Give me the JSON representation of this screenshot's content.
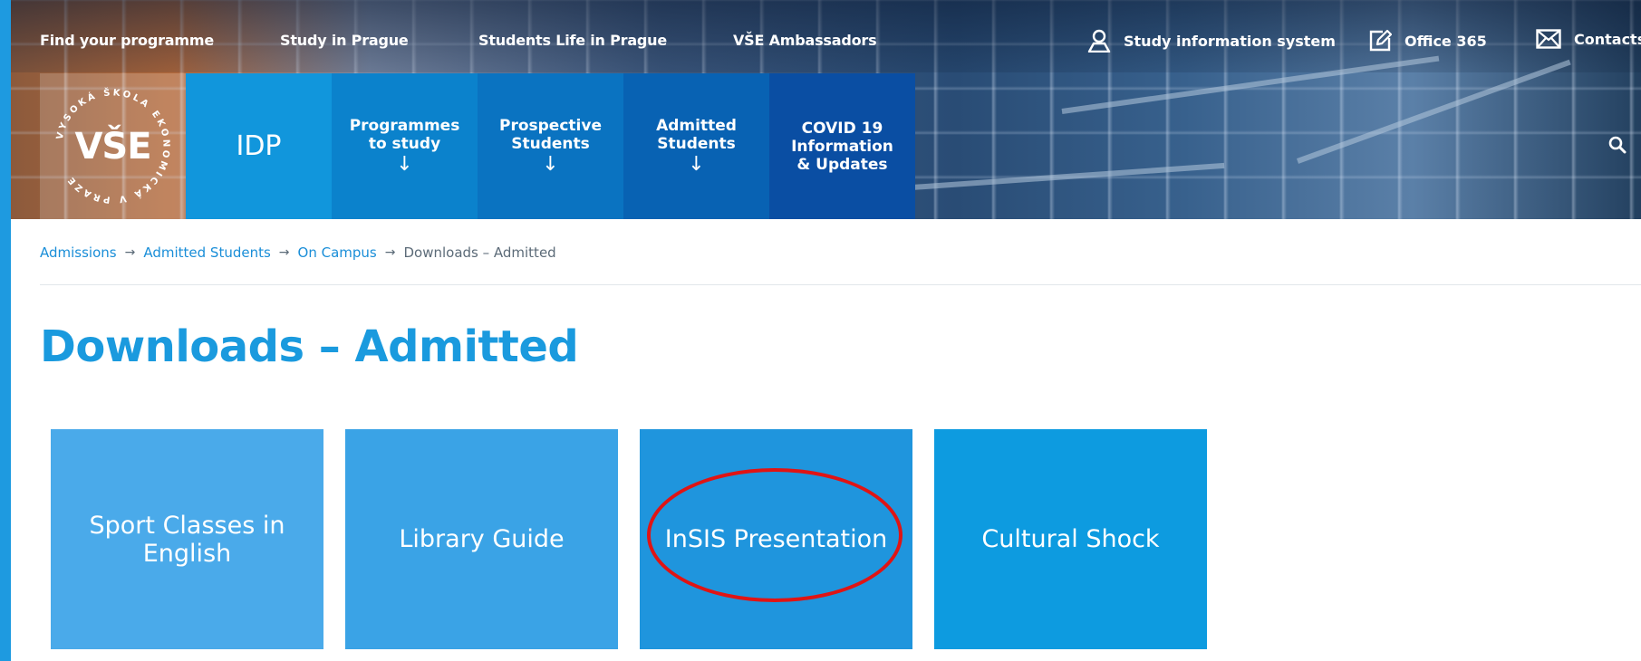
{
  "top_nav": {
    "links": [
      "Find your programme",
      "Study in Prague",
      "Students Life in Prague",
      "VŠE Ambassadors"
    ],
    "utility": {
      "study_system": "Study information system",
      "office": "Office 365",
      "contacts": "Contacts"
    }
  },
  "logo": {
    "text": "VŠE",
    "ring_text": "VYSOKÁ ŠKOLA EKONOMICKÁ V PRAZE"
  },
  "main_nav": {
    "home": "IDP",
    "programmes": {
      "line1": "Programmes",
      "line2": "to study",
      "arrow": "↓"
    },
    "prospective": {
      "line1": "Prospective",
      "line2": "Students",
      "arrow": "↓"
    },
    "admitted": {
      "line1": "Admitted",
      "line2": "Students",
      "arrow": "↓"
    },
    "covid": {
      "line1": "COVID 19",
      "line2": "Information",
      "line3": "& Updates"
    }
  },
  "breadcrumb": {
    "items": [
      "Admissions",
      "Admitted Students",
      "On Campus"
    ],
    "current": "Downloads – Admitted",
    "separator": "→"
  },
  "page": {
    "title": "Downloads – Admitted"
  },
  "downloads": [
    {
      "label": "Sport Classes in English",
      "color": "#4aaaea"
    },
    {
      "label": "Library Guide",
      "color": "#3aa3e6"
    },
    {
      "label": "InSIS Presentation",
      "color": "#1f95dd"
    },
    {
      "label": "Cultural Shock",
      "color": "#0d9be0"
    }
  ],
  "colors": {
    "accent": "#1a9ade",
    "nav_home": "#1196dc",
    "nav_1": "#0b82cc",
    "nav_2": "#0a73c1",
    "nav_3": "#0862b3",
    "nav_4": "#0a4ea3",
    "annotation": "#e01414"
  }
}
